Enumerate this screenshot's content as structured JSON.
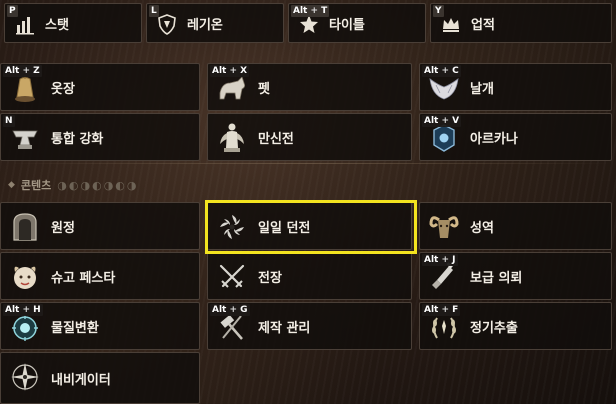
{
  "top_bar": [
    {
      "key": "P",
      "label": "스탯",
      "icon": "bar-chart-icon"
    },
    {
      "key": "L",
      "label": "레기온",
      "icon": "legion-shield-icon"
    },
    {
      "key": "Alt",
      "key2": "T",
      "label": "타이틀",
      "icon": "title-star-icon"
    },
    {
      "key": "Y",
      "label": "업적",
      "icon": "crown-icon"
    }
  ],
  "menu_rows": [
    [
      {
        "key": "Alt",
        "key2": "Z",
        "label": "옷장",
        "icon": "wardrobe-icon"
      },
      {
        "key": "Alt",
        "key2": "X",
        "label": "펫",
        "icon": "pet-wolf-icon"
      },
      {
        "key": "Alt",
        "key2": "C",
        "label": "날개",
        "icon": "wings-icon"
      }
    ],
    [
      {
        "key": "N",
        "label": "통합 강화",
        "icon": "anvil-icon"
      },
      {
        "key": "",
        "label": "만신전",
        "icon": "pantheon-statue-icon"
      },
      {
        "key": "Alt",
        "key2": "V",
        "label": "아르카나",
        "icon": "arcana-card-icon"
      }
    ]
  ],
  "section": {
    "title": "콘텐츠",
    "deco": "◑◐◑◐◑◐◑"
  },
  "content_rows": [
    [
      {
        "key": "",
        "label": "원정",
        "icon": "expedition-gate-icon"
      },
      {
        "key": "",
        "label": "일일 던전",
        "icon": "daily-dungeon-swirl-icon",
        "highlighted": true
      },
      {
        "key": "",
        "label": "성역",
        "icon": "sanctuary-ram-icon"
      }
    ],
    [
      {
        "key": "",
        "label": "슈고 페스타",
        "icon": "shugo-icon"
      },
      {
        "key": "",
        "label": "전장",
        "icon": "crossed-swords-icon"
      },
      {
        "key": "Alt",
        "key2": "J",
        "label": "보급 의뢰",
        "icon": "supply-flask-icon"
      }
    ],
    [
      {
        "key": "Alt",
        "key2": "H",
        "label": "물질변환",
        "icon": "transmute-orb-icon"
      },
      {
        "key": "Alt",
        "key2": "G",
        "label": "제작 관리",
        "icon": "crafting-hammer-icon"
      },
      {
        "key": "Alt",
        "key2": "F",
        "label": "정기추출",
        "icon": "extract-wreath-icon"
      }
    ],
    [
      {
        "key": "",
        "label": "내비게이터",
        "icon": "navigator-compass-icon"
      }
    ]
  ]
}
